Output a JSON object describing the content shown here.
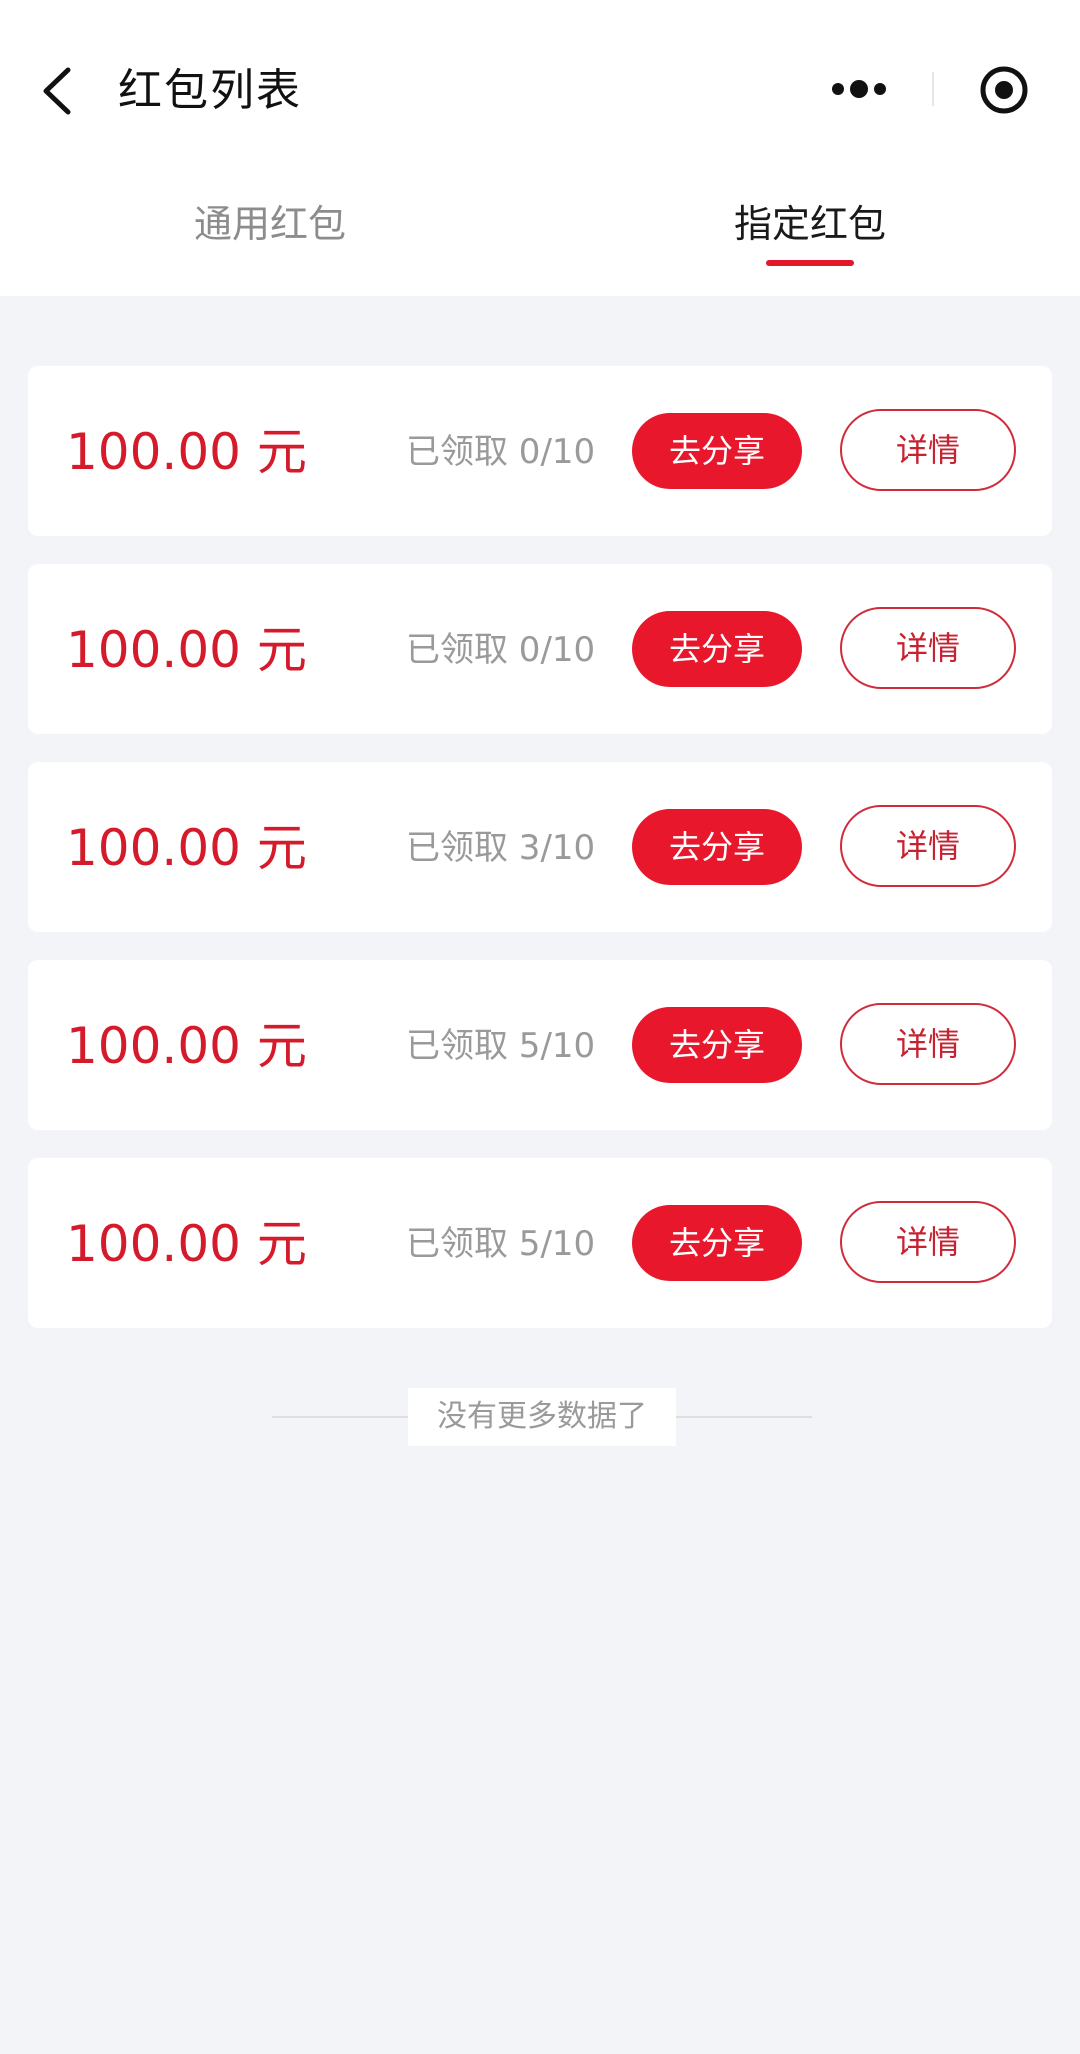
{
  "header": {
    "title": "红包列表",
    "back_icon": "chevron-left-icon",
    "more_icon": "more-dots-icon",
    "close_icon": "target-circle-icon"
  },
  "tabs": [
    {
      "label": "通用红包",
      "active": false
    },
    {
      "label": "指定红包",
      "active": true
    }
  ],
  "colors": {
    "accent": "#e8172c",
    "amount": "#d41a2b",
    "page_background": "#f3f4f8"
  },
  "items": [
    {
      "amount": "100.00 元",
      "claimed": "已领取 0/10",
      "share_label": "去分享",
      "detail_label": "详情"
    },
    {
      "amount": "100.00 元",
      "claimed": "已领取 0/10",
      "share_label": "去分享",
      "detail_label": "详情"
    },
    {
      "amount": "100.00 元",
      "claimed": "已领取 3/10",
      "share_label": "去分享",
      "detail_label": "详情"
    },
    {
      "amount": "100.00 元",
      "claimed": "已领取 5/10",
      "share_label": "去分享",
      "detail_label": "详情"
    },
    {
      "amount": "100.00 元",
      "claimed": "已领取 5/10",
      "share_label": "去分享",
      "detail_label": "详情"
    }
  ],
  "footer": {
    "no_more_text": "没有更多数据了"
  }
}
